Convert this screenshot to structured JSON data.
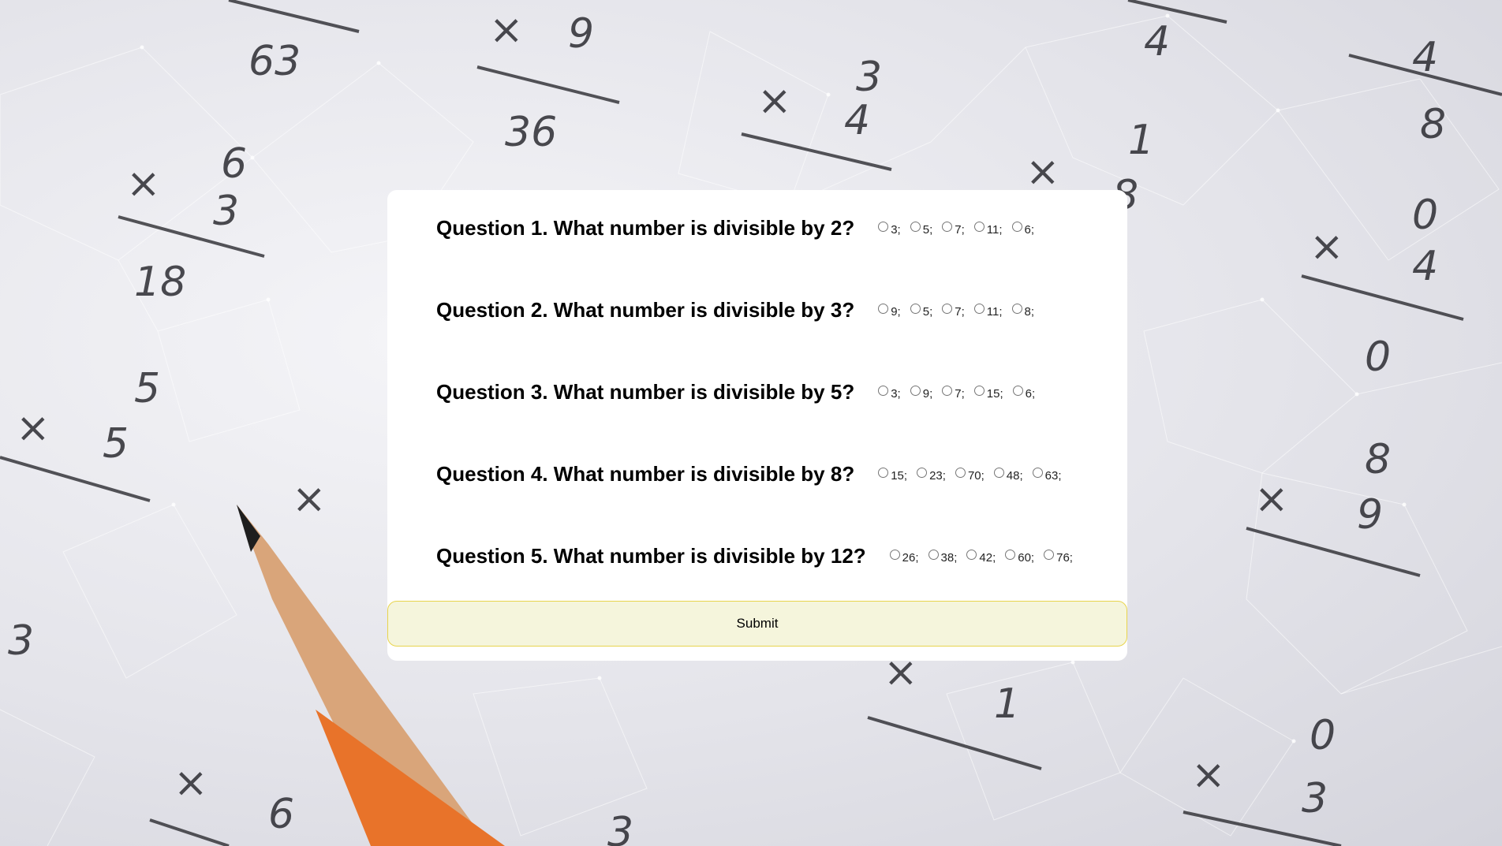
{
  "questions": [
    {
      "text": "Question 1. What number is divisible by 2?",
      "options": [
        "3;",
        "5;",
        "7;",
        "11;",
        "6;"
      ]
    },
    {
      "text": "Question 2. What number is divisible by 3?",
      "options": [
        "9;",
        "5;",
        "7;",
        "11;",
        "8;"
      ]
    },
    {
      "text": "Question 3. What number is divisible by 5?",
      "options": [
        "3;",
        "9;",
        "7;",
        "15;",
        "6;"
      ]
    },
    {
      "text": "Question 4. What number is divisible by 8?",
      "options": [
        "15;",
        "23;",
        "70;",
        "48;",
        "63;"
      ]
    },
    {
      "text": "Question 5. What number is divisible by 12?",
      "options": [
        "26;",
        "38;",
        "42;",
        "60;",
        "76;"
      ]
    }
  ],
  "submit_label": "Submit",
  "colors": {
    "card_background": "#ffffff",
    "submit_background": "#f5f5dc",
    "submit_border": "#e8d44d"
  },
  "background": {
    "description_icon": "math-worksheet-with-pencil",
    "handwritten_numbers": [
      "63",
      "36",
      "18",
      "3",
      "4",
      "6",
      "5",
      "8",
      "0",
      "9",
      "1",
      "4"
    ]
  }
}
